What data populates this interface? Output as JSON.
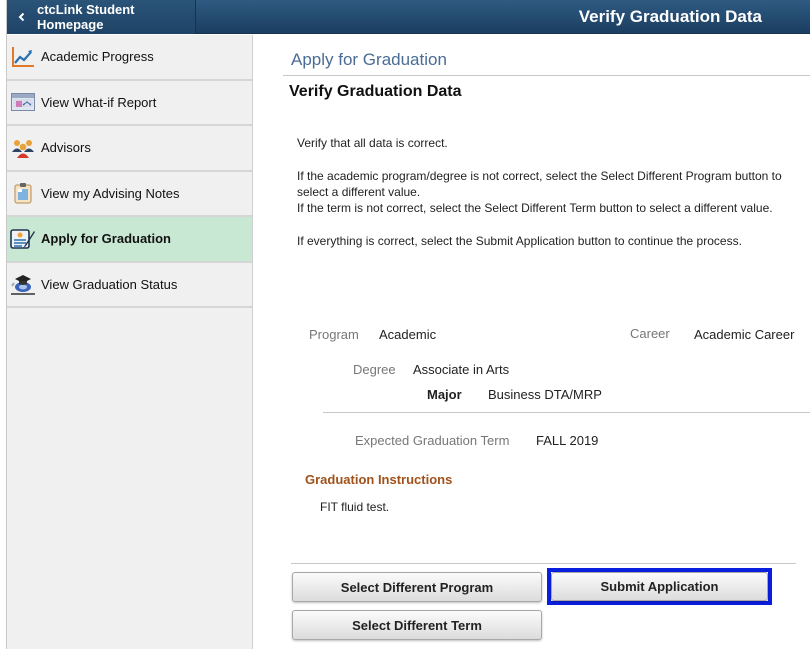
{
  "header": {
    "home_button_label": "ctcLink Student Homepage",
    "title": "Verify Graduation Data"
  },
  "sidebar": {
    "items": [
      {
        "label": "Academic Progress",
        "icon": "line-chart-icon",
        "active": false
      },
      {
        "label": "View What-if Report",
        "icon": "report-icon",
        "active": false
      },
      {
        "label": "Advisors",
        "icon": "people-icon",
        "active": false
      },
      {
        "label": "View my Advising Notes",
        "icon": "clipboard-icon",
        "active": false
      },
      {
        "label": "Apply for Graduation",
        "icon": "application-form-icon",
        "active": true
      },
      {
        "label": "View Graduation Status",
        "icon": "graduation-cap-icon",
        "active": false
      }
    ]
  },
  "main": {
    "subtitle": "Apply for Graduation",
    "heading": "Verify Graduation Data",
    "instructions": [
      "Verify that all data is correct.",
      "If the academic program/degree is not correct, select the Select Different Program button to select a different value.",
      "If the term is not correct, select the Select Different Term button to select a different value.",
      "If everything is correct, select the Submit Application button to continue the process."
    ],
    "instruction_lines": {
      "l1": "Verify that all data is correct.",
      "l2a": "If the academic program/degree is not correct, select the Select Different Program button to",
      "l2b": "select a different value.",
      "l3": "If the term is not correct, select the Select Different Term button to select a different value.",
      "l4": "If everything is correct, select the Submit Application button to continue the process."
    },
    "fields": {
      "program_label": "Program",
      "program_value": "Academic",
      "career_label": "Career",
      "career_value": "Academic Career",
      "degree_label": "Degree",
      "degree_value": "Associate in Arts",
      "major_label": "Major",
      "major_value": "Business DTA/MRP",
      "term_label": "Expected Graduation Term",
      "term_value": "FALL 2019"
    },
    "graduation_instructions": {
      "title": "Graduation Instructions",
      "text": "FIT fluid test."
    },
    "buttons": {
      "select_program": "Select Different Program",
      "submit": "Submit Application",
      "select_term": "Select Different Term"
    }
  },
  "colors": {
    "header": "#1f4468",
    "active_nav": "#c9e8d3",
    "subtitle": "#4a6c95",
    "section_title": "#a0521a",
    "highlight": "#0a1ee0"
  }
}
